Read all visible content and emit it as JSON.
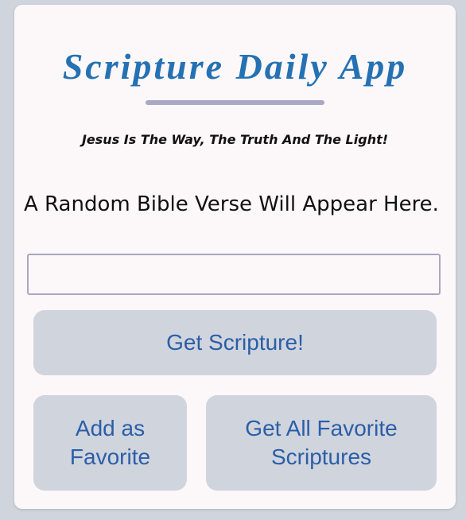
{
  "header": {
    "title": "Scripture Daily App",
    "tagline": "Jesus Is The Way, The Truth And The Light!"
  },
  "verse": {
    "placeholder_text": "A Random Bible Verse Will Appear Here."
  },
  "input": {
    "value": ""
  },
  "buttons": {
    "get_scripture": "Get Scripture!",
    "add_favorite": "Add as Favorite",
    "get_all_favorites": "Get All Favorite Scriptures"
  },
  "colors": {
    "title": "#2471b3",
    "button_text": "#2b5ea7",
    "button_bg": "#d0d4dd",
    "divider": "#aaa8c6",
    "card_bg": "#fcf7f9",
    "page_bg": "#d0d4dc"
  }
}
